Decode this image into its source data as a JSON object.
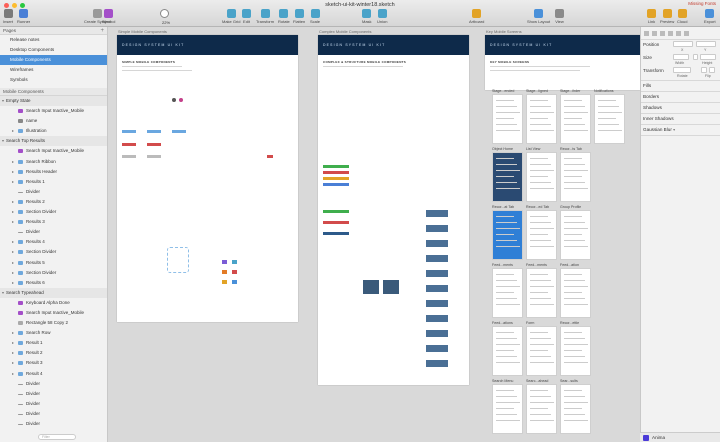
{
  "window": {
    "title": "sketch-ui-kit-winter18.sketch",
    "missing_font": "Missing Fonts",
    "zoom": "22%"
  },
  "toolbar": {
    "left": [
      {
        "label": "Insert",
        "icon": "plus-icon",
        "color": "#6a6a6a"
      },
      {
        "label": "Runner",
        "icon": "runner-icon",
        "color": "#4a7fd6"
      },
      {
        "label": "Create Symbol",
        "icon": "symbol-icon",
        "color": "#8a8a8a"
      },
      {
        "label": "Symbol",
        "icon": "symbol-menu-icon",
        "color": "#a44fc9"
      },
      {
        "label": "Zoom",
        "icon": "zoom-icon",
        "color": "#6a6a6a"
      }
    ],
    "middle": [
      {
        "label": "Make Grid",
        "icon": "grid-icon",
        "color": "#4aa3c9"
      },
      {
        "label": "Edit",
        "icon": "edit-icon",
        "color": "#4aa3c9"
      },
      {
        "label": "Transform",
        "icon": "transform-icon",
        "color": "#4aa3c9"
      },
      {
        "label": "Rotate",
        "icon": "rotate-icon",
        "color": "#4aa3c9"
      },
      {
        "label": "Flatten",
        "icon": "flatten-icon",
        "color": "#4aa3c9"
      },
      {
        "label": "Scale",
        "icon": "scale-icon",
        "color": "#4aa3c9"
      },
      {
        "label": "Mask",
        "icon": "mask-icon",
        "color": "#4aa3c9"
      },
      {
        "label": "Union",
        "icon": "union-icon",
        "color": "#4aa3c9"
      }
    ],
    "artboard": {
      "label": "Artboard",
      "icon": "artboard-icon",
      "color": "#e2a326"
    },
    "right_mid": [
      {
        "label": "Show Layout",
        "icon": "layout-icon",
        "color": "#4a90d9"
      },
      {
        "label": "View",
        "icon": "view-icon",
        "color": "#6a6a6a"
      }
    ],
    "right": [
      {
        "label": "Link",
        "icon": "link-icon",
        "color": "#e2a326"
      },
      {
        "label": "Preview",
        "icon": "preview-icon",
        "color": "#e2a326"
      },
      {
        "label": "Cloud",
        "icon": "cloud-icon",
        "color": "#e2a326"
      },
      {
        "label": "Export",
        "icon": "export-icon",
        "color": "#4a90d9"
      }
    ]
  },
  "sidebar": {
    "pages_title": "Pages",
    "pages": [
      {
        "label": "Release notes",
        "selected": false
      },
      {
        "label": "Desktop Components",
        "selected": false
      },
      {
        "label": "Mobile Components",
        "selected": true
      },
      {
        "label": "Wireframes",
        "selected": false
      },
      {
        "label": "Symbols",
        "selected": false
      }
    ],
    "layers_title": "Mobile Components",
    "layers": [
      {
        "label": "Empty State",
        "depth": 0,
        "type": "group-open"
      },
      {
        "label": "Search Input Inactive_Mobile",
        "depth": 1,
        "type": "symbol"
      },
      {
        "label": "name",
        "depth": 1,
        "type": "text"
      },
      {
        "label": "Illustration",
        "depth": 1,
        "type": "folder"
      },
      {
        "label": "Search Top Results",
        "depth": 0,
        "type": "group-open"
      },
      {
        "label": "Search Input Inactive_Mobile",
        "depth": 1,
        "type": "symbol"
      },
      {
        "label": "Search Ribbon",
        "depth": 1,
        "type": "folder"
      },
      {
        "label": "Results Header",
        "depth": 1,
        "type": "folder"
      },
      {
        "label": "Results 1",
        "depth": 1,
        "type": "folder"
      },
      {
        "label": "Divider",
        "depth": 1,
        "type": "line"
      },
      {
        "label": "Results 2",
        "depth": 1,
        "type": "folder"
      },
      {
        "label": "Section Divider",
        "depth": 1,
        "type": "folder"
      },
      {
        "label": "Results 3",
        "depth": 1,
        "type": "folder"
      },
      {
        "label": "Divider",
        "depth": 1,
        "type": "line"
      },
      {
        "label": "Results 4",
        "depth": 1,
        "type": "folder"
      },
      {
        "label": "Section Divider",
        "depth": 1,
        "type": "folder"
      },
      {
        "label": "Results 5",
        "depth": 1,
        "type": "folder"
      },
      {
        "label": "Section Divider",
        "depth": 1,
        "type": "folder"
      },
      {
        "label": "Results 6",
        "depth": 1,
        "type": "folder"
      },
      {
        "label": "Search Typeahead",
        "depth": 0,
        "type": "group-open"
      },
      {
        "label": "Keyboard Alpha Done",
        "depth": 1,
        "type": "symbol"
      },
      {
        "label": "Search Input Inactive_Mobile",
        "depth": 1,
        "type": "symbol"
      },
      {
        "label": "Rectangle 58 Copy 2",
        "depth": 1,
        "type": "rect"
      },
      {
        "label": "Search Row",
        "depth": 1,
        "type": "folder"
      },
      {
        "label": "Result 1",
        "depth": 1,
        "type": "folder"
      },
      {
        "label": "Result 2",
        "depth": 1,
        "type": "folder"
      },
      {
        "label": "Result 3",
        "depth": 1,
        "type": "folder"
      },
      {
        "label": "Result 4",
        "depth": 1,
        "type": "folder"
      },
      {
        "label": "Divider",
        "depth": 1,
        "type": "line"
      },
      {
        "label": "Divider",
        "depth": 1,
        "type": "line"
      },
      {
        "label": "Divider",
        "depth": 1,
        "type": "line"
      },
      {
        "label": "Divider",
        "depth": 1,
        "type": "line"
      },
      {
        "label": "Divider",
        "depth": 1,
        "type": "line"
      }
    ],
    "filter_placeholder": "Filter"
  },
  "canvas": {
    "artboards": [
      {
        "label": "Simple Mobile Components",
        "header": "DESIGN SYSTEM UI KIT",
        "sub": "SIMPLE MOBILE COMPONENTS"
      },
      {
        "label": "Complex Mobile Components",
        "header": "DESIGN SYSTEM UI KIT",
        "sub": "COMPLEX & STRUCTURE MOBILE COMPONENTS"
      },
      {
        "label": "Key Mobile Screens",
        "header": "DESIGN SYSTEM UI KIT",
        "sub": "KEY MOBILE SCREENS"
      }
    ],
    "phone_labels": [
      "Stage...ended",
      "Stage...ligned",
      "Stage...ihder",
      "Notifications",
      "Object Home",
      "List View",
      "Recor...ts Tab",
      "Recor...at Tab",
      "Recor...ed Tab",
      "Group Profile",
      "Feed...ments",
      "Feed...ments",
      "Feed...ation",
      "Feed...ations",
      "Form",
      "Recor...ettle",
      "Search Menu",
      "Searc...ahead",
      "Sear...sults"
    ]
  },
  "inspector": {
    "position": "Position",
    "size": "Size",
    "transform": "Transform",
    "x": "X",
    "y": "Y",
    "width": "Width",
    "height": "Height",
    "rotate": "Rotate",
    "flip": "Flip",
    "fills": "Fills",
    "borders": "Borders",
    "shadows": "Shadows",
    "inner_shadows": "Inner Shadows",
    "gaussian_blur": "Gaussian Blur"
  },
  "plugin": {
    "label": "Anima"
  }
}
